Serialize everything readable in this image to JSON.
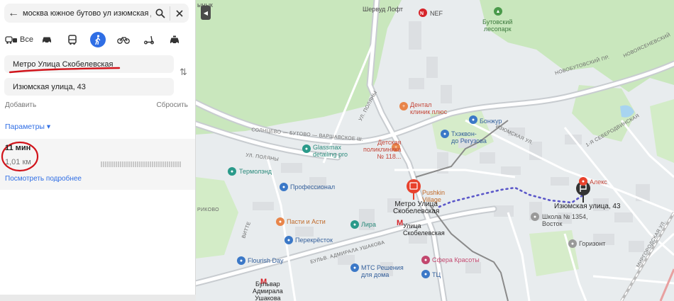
{
  "search": {
    "query": "москва южное бутово ул изюмская д"
  },
  "modes": {
    "all_label": "Все"
  },
  "route": {
    "point_a": "Метро Улица Скобелевская",
    "point_b": "Изюмская улица, 43",
    "add_label": "Добавить",
    "reset_label": "Сбросить",
    "params_label": "Параметры ▾",
    "duration": "11 мин",
    "distance": "1,01 км",
    "details_label": "Посмотреть подробнее"
  },
  "colors": {
    "accent": "#2f6ee5",
    "point_a": "#e63a2e",
    "route_walk": "#5b57c9",
    "marker_red": "#e8412c"
  },
  "icons": [
    "back-arrow-icon",
    "search-icon",
    "close-icon",
    "car-bus-walk-icon",
    "car-icon",
    "bus-icon",
    "walk-icon",
    "bike-icon",
    "scooter-icon",
    "taxi-icon",
    "swap-icon"
  ],
  "map": {
    "labels": {
      "shinik": "ынык",
      "sherwood": "Шервуд Лофт",
      "nef": "NEF",
      "butovo_park": "Бутовский\nлесопарк",
      "novobut": "НОВОБУТОВСКИЙ ПР.",
      "solntsevo": "СОЛНЦЕВО — БУТОВО — ВАРШАВСКОЕ Ш.",
      "ul_polyany": "УЛ. ПОЛЯНЫ",
      "dental": "Дентал\nклиник плюс",
      "bonjour": "Бонжур",
      "tkhekvon": "Тхэквон-\nдо Регузова",
      "izyumskaya_street": "ИЗЮМСКАЯ УЛ.",
      "glassmax": "Glassmax\ndetailing pro",
      "det_poli": "Детская\nполиклиника\n№ 118...",
      "termolend": "Термолэнд",
      "professional": "Профессионал",
      "pushkin": "Pushkin\nVillage",
      "metro_top": "Метро Улица\nСкобелевская",
      "alex": "Алекс",
      "izyum43": "Изюмская улица, 43",
      "school": "Школа № 1354,\nВосток",
      "pasti": "Пасти и Асти",
      "lira": "Лира",
      "metro_bottom": "Улица\nСкобелевская",
      "perekrestok": "Перекрёсток",
      "gorizont": "Горизонт",
      "flourish": "Flourish Day",
      "ushakova_street": "БУЛЬВ. АДМИРАЛА УШАКОВА",
      "mts": "МТС Решения\nдля дома",
      "sfera": "Сфера Красоты",
      "tc": "ТЦ",
      "bulvar": "Бульвар\nАдмирала\nУшакова",
      "vitte": "ВИТТЕ",
      "rikovo": "РИКОВО",
      "severnaya": "1-Я СЕВЕРОДВИНСКАЯ",
      "mirgorod": "МИРГОРОДСКАЯ УЛ.",
      "novoyasen": "НОВОЯСЕНЕВСКИЙ"
    }
  }
}
